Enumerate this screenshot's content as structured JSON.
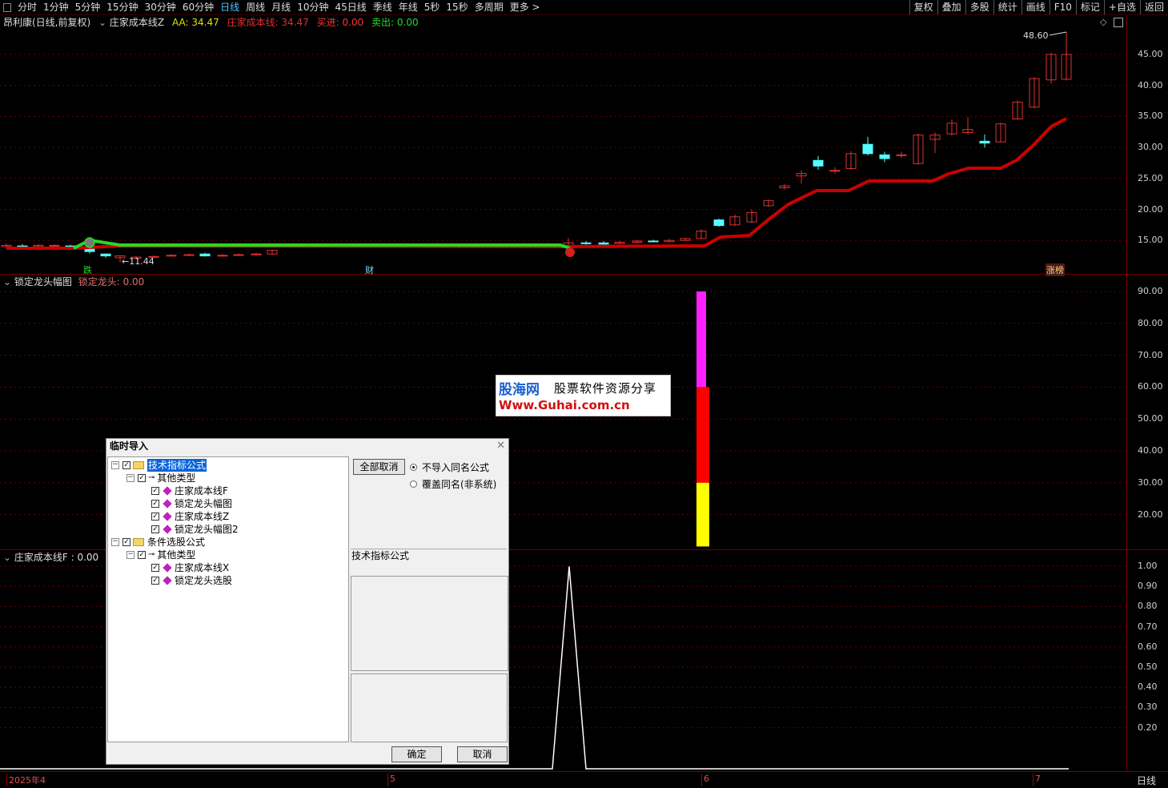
{
  "toolbar": {
    "periods": [
      "分时",
      "1分钟",
      "5分钟",
      "15分钟",
      "30分钟",
      "60分钟",
      "日线",
      "周线",
      "月线",
      "10分钟",
      "45日线",
      "季线",
      "年线",
      "5秒",
      "15秒",
      "多周期",
      "更多 >"
    ],
    "active_period": "日线",
    "right_buttons": [
      "复权",
      "叠加",
      "多股",
      "统计",
      "画线",
      "F10",
      "标记",
      "+自选",
      "返回"
    ]
  },
  "main_pane": {
    "stock_title": "昂利康(日线,前复权)",
    "indicator_name": "庄家成本线Z",
    "aa_label": "AA: 34.47",
    "cost_label": "庄家成本线: 34.47",
    "buy_label": "买进: 0.00",
    "sell_label": "卖出: 0.00",
    "high_label": "48.60",
    "low_label": "11.44",
    "annotations": [
      "跌",
      "财",
      "涨榜"
    ],
    "y_ticks": [
      "45.00",
      "40.00",
      "35.00",
      "30.00",
      "25.00",
      "20.00",
      "15.00"
    ]
  },
  "pane2": {
    "indicator_name": "锁定龙头幅图",
    "value_label": "锁定龙头: 0.00",
    "y_ticks": [
      "90.00",
      "80.00",
      "70.00",
      "60.00",
      "50.00",
      "40.00",
      "30.00",
      "20.00"
    ]
  },
  "pane3": {
    "indicator_name": "庄家成本线F : 0.00",
    "y_ticks": [
      "1.00",
      "0.90",
      "0.80",
      "0.70",
      "0.60",
      "0.50",
      "0.40",
      "0.30",
      "0.20"
    ]
  },
  "x_axis": {
    "labels": [
      "2025年4",
      "5",
      "6",
      "7"
    ],
    "period_label": "日线"
  },
  "watermark": {
    "brand": "股海网",
    "slogan": "股票软件资源分享",
    "url": "Www.Guhai.com.cn"
  },
  "dialog": {
    "title": "临时导入",
    "tree": [
      {
        "label": "技术指标公式",
        "level": 0,
        "type": "folder",
        "selected": true
      },
      {
        "label": "其他类型",
        "level": 1,
        "type": "key"
      },
      {
        "label": "庄家成本线F",
        "level": 2,
        "type": "item"
      },
      {
        "label": "锁定龙头幅图",
        "level": 2,
        "type": "item"
      },
      {
        "label": "庄家成本线Z",
        "level": 2,
        "type": "item"
      },
      {
        "label": "锁定龙头幅图2",
        "level": 2,
        "type": "item"
      },
      {
        "label": "条件选股公式",
        "level": 0,
        "type": "folder"
      },
      {
        "label": "其他类型",
        "level": 1,
        "type": "key"
      },
      {
        "label": "庄家成本线X",
        "level": 2,
        "type": "item"
      },
      {
        "label": "锁定龙头选股",
        "level": 2,
        "type": "item"
      }
    ],
    "cancel_all": "全部取消",
    "radio_no_import": "不导入同名公式",
    "radio_overwrite": "覆盖同名(非系统)",
    "info_label": "技术指标公式",
    "ok": "确定",
    "cancel": "取消"
  },
  "colors": {
    "up": "#e03030",
    "down": "#54ffff",
    "cost_red": "#cc0000",
    "cost_green": "#22dd22",
    "grid": "#7a0000"
  }
}
